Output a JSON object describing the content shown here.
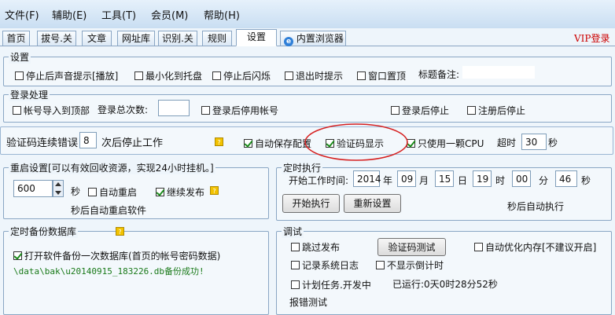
{
  "menu": [
    "文件(F)",
    "辅助(E)",
    "工具(T)",
    "会员(M)",
    "帮助(H)"
  ],
  "tabs": [
    "首页",
    "拔号.关",
    "文章",
    "网址库",
    "识别.关",
    "规则",
    "设置",
    "内置浏览器"
  ],
  "vip_login": "VIP登录",
  "settings": {
    "title": "设置",
    "stop_sound": "停止后声音提示[播放]",
    "minimize_tray": "最小化到托盘",
    "flash_stop": "停止后闪烁",
    "exit_prompt": "退出时提示",
    "window_top": "窗口置顶",
    "title_note_label": "标题备注:",
    "title_note_value": ""
  },
  "login": {
    "title": "登录处理",
    "import_top": "帐号导入到顶部",
    "login_count_label": "登录总次数:",
    "login_count_value": "",
    "disable_after_login": "登录后停用帐号",
    "stop_after_login": "登录后停止",
    "stop_after_register": "注册后停止"
  },
  "captcha": {
    "error_label": "验证码连续错误",
    "error_value": "8",
    "stop_label": "次后停止工作",
    "auto_save": "自动保存配置",
    "show_captcha": "验证码显示",
    "one_cpu": "只使用一颗CPU",
    "timeout_label": "超时",
    "timeout_value": "30",
    "timeout_unit": "秒"
  },
  "restart": {
    "title": "重启设置[可以有效回收资源，实现24小时挂机。]",
    "seconds_value": "600",
    "seconds_unit": "秒",
    "auto_restart": "自动重启",
    "continue_publish": "继续发布",
    "note": "秒后自动重启软件"
  },
  "schedule": {
    "title": "定时执行",
    "start_label": "开始工作时间:",
    "year": "2014",
    "year_unit": "年",
    "month": "09",
    "month_unit": "月",
    "day": "15",
    "day_unit": "日",
    "hour": "19",
    "hour_unit": "时",
    "minute": "00",
    "minute_unit": "分",
    "second": "46",
    "second_unit": "秒",
    "start_button": "开始执行",
    "reset_button": "重新设置",
    "note": "秒后自动执行"
  },
  "backup": {
    "title": "定时备份数据库",
    "open_backup": "打开软件备份一次数据库(首页的帐号密码数据)",
    "status": "\\data\\bak\\u20140915_183226.db备份成功!"
  },
  "debug": {
    "title": "调试",
    "skip_publish": "跳过发布",
    "captcha_test": "验证码测试",
    "auto_optimize": "自动优化内存[不建议开启]",
    "log": "记录系统日志",
    "no_countdown": "不显示倒计时",
    "scheduled_task": "计划任务.开发中",
    "running": "已运行:0天0时28分52秒",
    "error_test": "报错测试"
  },
  "colors": {
    "vip": "#cc0000",
    "highlight_ellipse": "#d62020",
    "status_text": "#1a7a1a"
  }
}
